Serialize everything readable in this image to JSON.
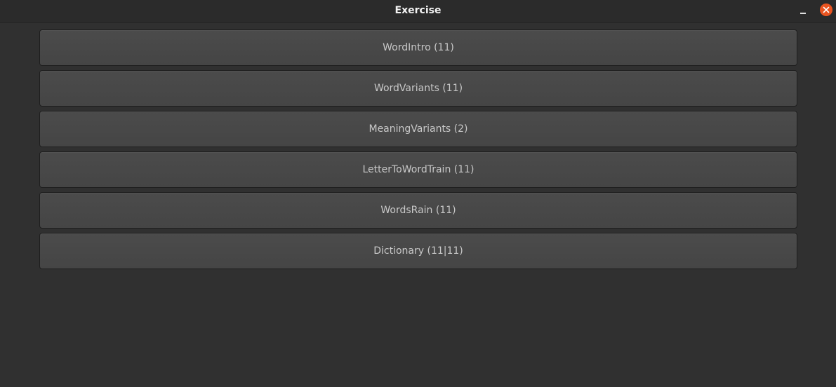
{
  "window": {
    "title": "Exercise"
  },
  "exercises": [
    {
      "label": "WordIntro (11)"
    },
    {
      "label": "WordVariants (11)"
    },
    {
      "label": "MeaningVariants (2)"
    },
    {
      "label": "LetterToWordTrain (11)"
    },
    {
      "label": "WordsRain (11)"
    },
    {
      "label": "Dictionary (11|11)"
    }
  ],
  "colors": {
    "background": "#303030",
    "titlebar": "#2b2b2b",
    "button": "#484848",
    "button_text": "#c8c8c8",
    "close_accent": "#e95420"
  }
}
